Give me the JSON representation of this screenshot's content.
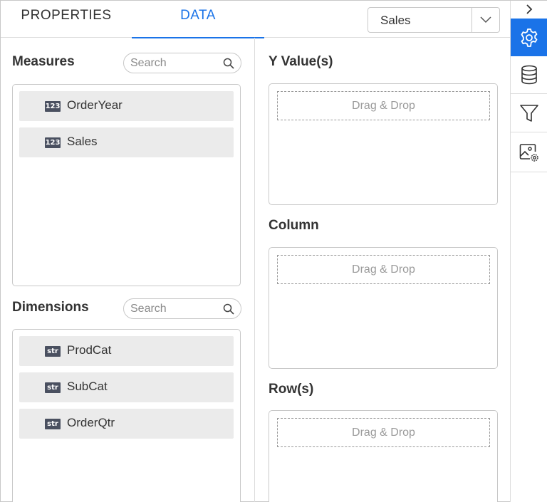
{
  "tabs": [
    {
      "label": "PROPERTIES",
      "active": false
    },
    {
      "label": "DATA",
      "active": true
    }
  ],
  "datasource": {
    "selected": "Sales"
  },
  "colors": {
    "accent": "#1a73e8",
    "badge": "#4a5060",
    "item_bg": "#ebebeb"
  },
  "measures": {
    "title": "Measures",
    "search_placeholder": "Search",
    "items": [
      {
        "badge": "123",
        "label": "OrderYear"
      },
      {
        "badge": "123",
        "label": "Sales"
      }
    ]
  },
  "dimensions": {
    "title": "Dimensions",
    "search_placeholder": "Search",
    "items": [
      {
        "badge": "str",
        "label": "ProdCat"
      },
      {
        "badge": "str",
        "label": "SubCat"
      },
      {
        "badge": "str",
        "label": "OrderQtr"
      }
    ]
  },
  "drop_zones": [
    {
      "title": "Y Value(s)",
      "placeholder": "Drag & Drop"
    },
    {
      "title": "Column",
      "placeholder": "Drag & Drop"
    },
    {
      "title": "Row(s)",
      "placeholder": "Drag & Drop"
    }
  ],
  "rail": {
    "icons": [
      "chevron-right-icon",
      "gear-icon",
      "database-icon",
      "filter-icon",
      "image-settings-icon"
    ]
  }
}
